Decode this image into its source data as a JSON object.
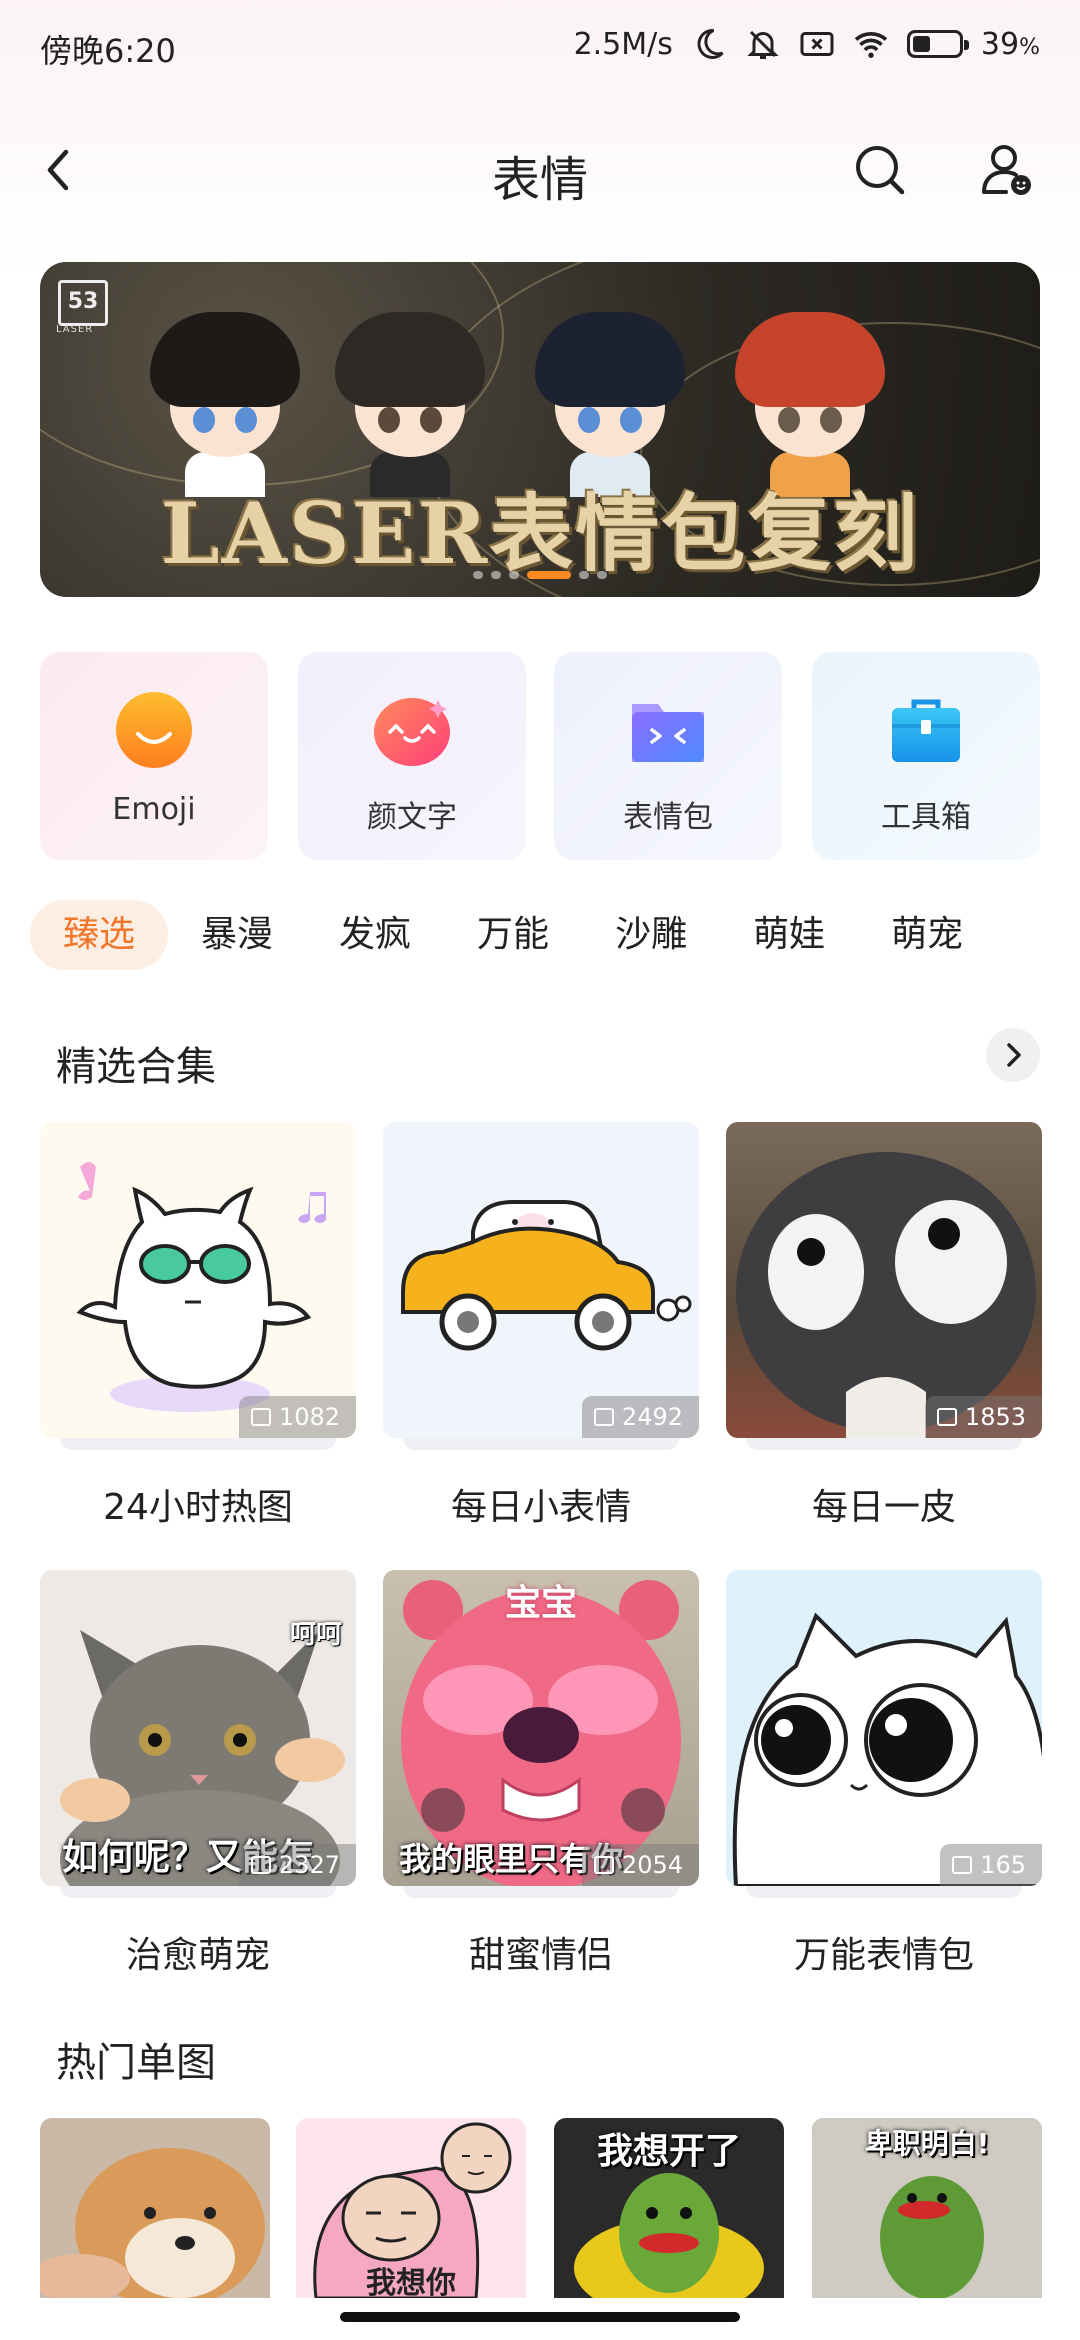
{
  "status_bar": {
    "time": "傍晚6:20",
    "speed": "2.5M/s",
    "battery_percent": "39",
    "battery_symbol": "%",
    "battery_level": 0.39,
    "icons": [
      "moon-icon",
      "bell-off-icon",
      "sim-x-icon",
      "wifi-icon",
      "battery-icon"
    ]
  },
  "header": {
    "title": "表情",
    "icons": [
      "back-arrow-icon",
      "search-icon",
      "profile-icon"
    ]
  },
  "banner": {
    "title": "LASER表情包复刻",
    "logo_text": "53",
    "logo_subtext": "LASER",
    "slide_count": 6,
    "active_slide": 3
  },
  "categories": [
    {
      "label": "Emoji",
      "icon": "emoji-face-icon",
      "color": "#ff9a1f"
    },
    {
      "label": "颜文字",
      "icon": "kaomoji-icon",
      "color": "#ff5a6e"
    },
    {
      "label": "表情包",
      "icon": "sticker-folder-icon",
      "color": "#7b6cff"
    },
    {
      "label": "工具箱",
      "icon": "toolbox-icon",
      "color": "#21a8f0"
    }
  ],
  "tabs": [
    "臻选",
    "暴漫",
    "发疯",
    "万能",
    "沙雕",
    "萌娃",
    "萌宠"
  ],
  "active_tab": "臻选",
  "featured": {
    "title": "精选合集",
    "items": [
      {
        "label": "24小时热图",
        "count": "1082"
      },
      {
        "label": "每日小表情",
        "count": "2492"
      },
      {
        "label": "每日一皮",
        "count": "1853"
      },
      {
        "label": "治愈萌宠",
        "count": "2327",
        "caption": "如何呢？又能怎",
        "corner_text": "呵呵"
      },
      {
        "label": "甜蜜情侣",
        "count": "2054",
        "caption": "我的眼里只有你",
        "top_text": "宝宝"
      },
      {
        "label": "万能表情包",
        "count": "165"
      }
    ]
  },
  "hot": {
    "title": "热门单图",
    "items": [
      {
        "caption": ""
      },
      {
        "caption": "我想你"
      },
      {
        "caption": "我想开了"
      },
      {
        "caption": "卑职明白!"
      }
    ]
  },
  "colors": {
    "accent": "#f2762a",
    "accent_bg": "#fdeee3",
    "banner_progress": "#ff8a1f"
  }
}
